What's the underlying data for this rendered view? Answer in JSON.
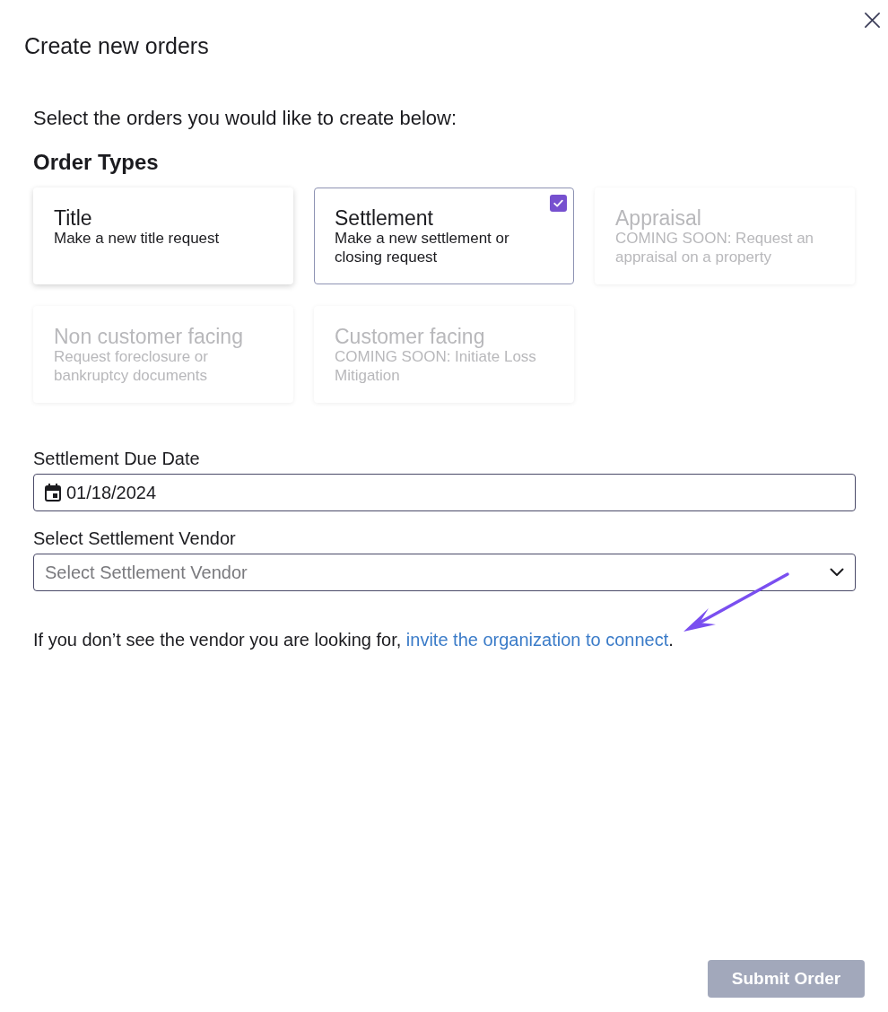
{
  "dialog": {
    "title": "Create new orders"
  },
  "intro": "Select the orders you would like to create below:",
  "order_types": {
    "heading": "Order Types",
    "cards": [
      {
        "title": "Title",
        "description": "Make a new title request",
        "selected": false,
        "disabled": false
      },
      {
        "title": "Settlement",
        "description": "Make a new settlement or closing request",
        "selected": true,
        "disabled": false
      },
      {
        "title": "Appraisal",
        "description": "COMING SOON: Request an appraisal on a property",
        "selected": false,
        "disabled": true
      },
      {
        "title": "Non customer facing",
        "description": "Request foreclosure or bankruptcy documents",
        "selected": false,
        "disabled": true
      },
      {
        "title": "Customer facing",
        "description": "COMING SOON: Initiate Loss Mitigation",
        "selected": false,
        "disabled": true
      }
    ]
  },
  "fields": [
    {
      "kind": "date",
      "label": "Settlement Due Date",
      "value": "01/18/2024"
    },
    {
      "kind": "select",
      "label": "Select Settlement Vendor",
      "placeholder": "Select Settlement Vendor"
    }
  ],
  "vendor_hint": {
    "text": "If you don’t see the vendor you are looking for, ",
    "link": "invite the organization to connect",
    "suffix": "."
  },
  "submit": {
    "label": "Submit Order",
    "disabled": true
  }
}
